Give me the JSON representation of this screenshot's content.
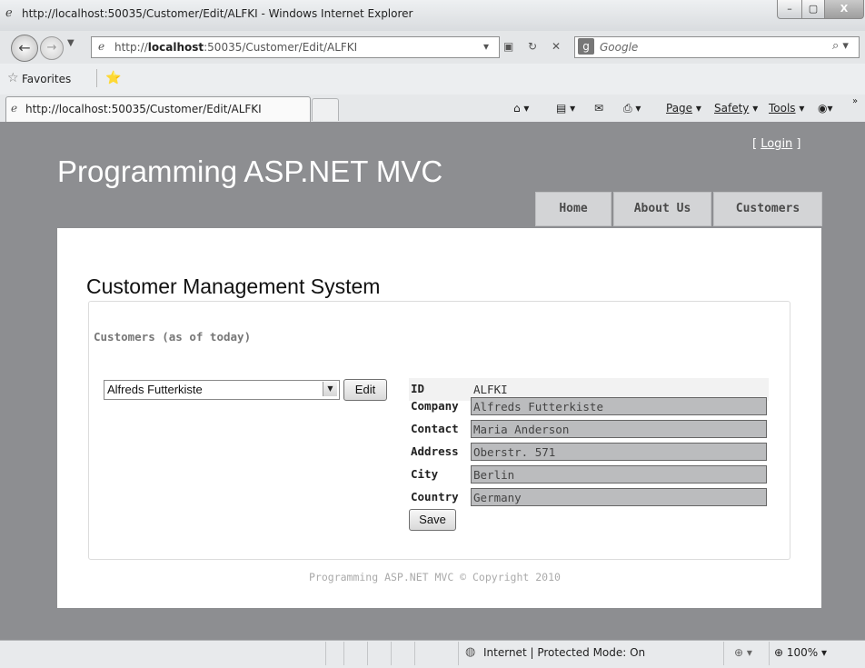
{
  "window": {
    "title": "http://localhost:50035/Customer/Edit/ALFKI - Windows Internet Explorer",
    "minimize": "–",
    "maximize": "▢",
    "close": "X"
  },
  "address_bar": {
    "url_prefix": "http://",
    "url_host": "localhost",
    "url_rest": ":50035/Customer/Edit/ALFKI",
    "search_placeholder": "Google"
  },
  "favorites_bar": {
    "label": "Favorites"
  },
  "tab": {
    "title": "http://localhost:50035/Customer/Edit/ALFKI"
  },
  "command_bar": {
    "page": "Page",
    "safety": "Safety",
    "tools": "Tools"
  },
  "site": {
    "login_open": "[ ",
    "login": "Login",
    "login_close": " ]",
    "title": "Programming ASP.NET MVC",
    "nav": [
      "Home",
      "About Us",
      "Customers"
    ]
  },
  "main": {
    "heading": "Customer Management System",
    "caption": "Customers (as of today)",
    "selected_customer": "Alfreds Futterkiste",
    "edit_label": "Edit",
    "save_label": "Save",
    "fields": [
      {
        "label": "ID",
        "value": "ALFKI"
      },
      {
        "label": "Company",
        "value": "Alfreds Futterkiste"
      },
      {
        "label": "Contact",
        "value": "Maria Anderson"
      },
      {
        "label": "Address",
        "value": "Oberstr. 571"
      },
      {
        "label": "City",
        "value": "Berlin"
      },
      {
        "label": "Country",
        "value": "Germany"
      }
    ],
    "footer": "Programming ASP.NET MVC © Copyright 2010"
  },
  "status_bar": {
    "zone": "Internet | Protected Mode: On",
    "zoom": "100%"
  }
}
